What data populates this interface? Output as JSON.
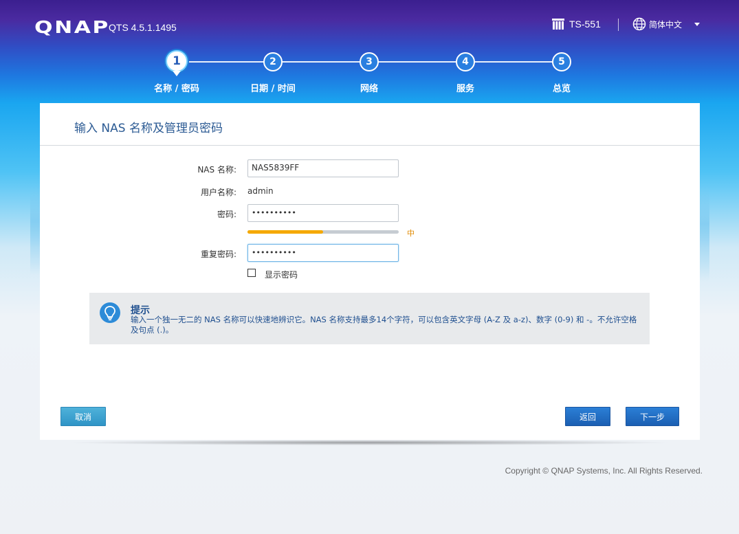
{
  "header": {
    "logo": "QNAP",
    "version": "QTS 4.5.1.1495",
    "model": "TS-551",
    "language": "简体中文"
  },
  "steps": [
    {
      "number": "1",
      "label": "名称 / 密码",
      "active": true
    },
    {
      "number": "2",
      "label": "日期 / 时间",
      "active": false
    },
    {
      "number": "3",
      "label": "网络",
      "active": false
    },
    {
      "number": "4",
      "label": "服务",
      "active": false
    },
    {
      "number": "5",
      "label": "总览",
      "active": false
    }
  ],
  "form": {
    "title": "输入 NAS 名称及管理员密码",
    "nas_name_label": "NAS 名称:",
    "nas_name_value": "NAS5839FF",
    "username_label": "用户名称:",
    "username_value": "admin",
    "password_label": "密码:",
    "password_value": "••••••••••",
    "password_strength_label": "中",
    "password_strength_fraction": 0.5,
    "confirm_label": "重复密码:",
    "confirm_value": "••••••••••",
    "show_password_label": "显示密码",
    "show_password_checked": false
  },
  "tip": {
    "title": "提示",
    "text": "输入一个独一无二的 NAS 名称可以快速地辨识它。NAS 名称支持最多14个字符，可以包含英文字母 (A-Z 及 a-z)、数字 (0-9) 和 -。不允许空格及句点 (.)。"
  },
  "buttons": {
    "cancel": "取消",
    "back": "返回",
    "next": "下一步"
  },
  "footer": {
    "copyright": "Copyright © QNAP Systems, Inc. All Rights Reserved."
  },
  "colors": {
    "accent": "#1b5fb2",
    "strength": "#f5a900",
    "title_text": "#2b5a93"
  }
}
